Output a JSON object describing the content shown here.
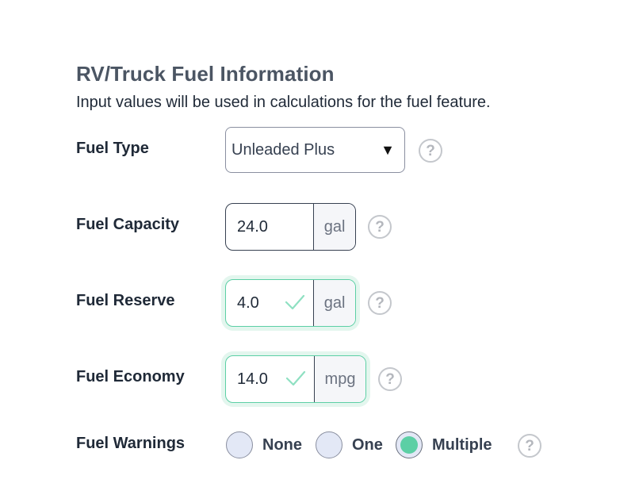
{
  "header": {
    "title": "RV/Truck Fuel Information",
    "subtitle": "Input values will be used in calculations for the fuel feature."
  },
  "fuel_type": {
    "label": "Fuel Type",
    "selected": "Unleaded Plus",
    "arrow": "▼",
    "help": "?"
  },
  "fuel_capacity": {
    "label": "Fuel Capacity",
    "value": "24.0",
    "unit": "gal",
    "help": "?"
  },
  "fuel_reserve": {
    "label": "Fuel Reserve",
    "value": "4.0",
    "unit": "gal",
    "help": "?",
    "status": "valid"
  },
  "fuel_economy": {
    "label": "Fuel Economy",
    "value": "14.0",
    "unit": "mpg",
    "help": "?",
    "status": "valid"
  },
  "fuel_warnings": {
    "label": "Fuel Warnings",
    "options": [
      "None",
      "One",
      "Multiple"
    ],
    "selected": "Multiple",
    "help": "?"
  },
  "colors": {
    "valid_border": "#5ccfa5",
    "radio_fill": "#e3e8f6",
    "radio_selected": "#5ccfa5"
  }
}
